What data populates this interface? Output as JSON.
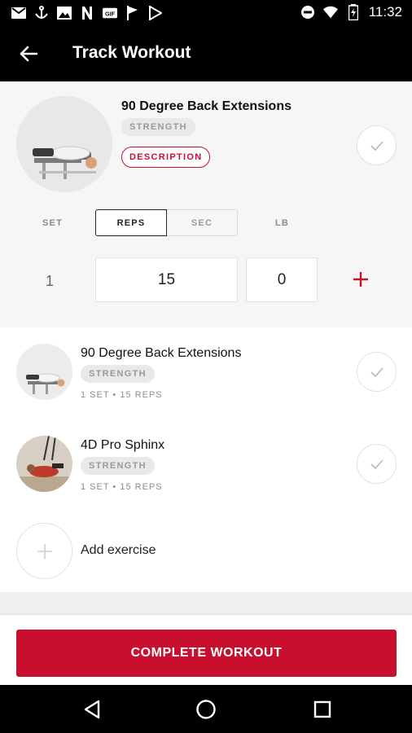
{
  "status_bar": {
    "time": "11:32",
    "left_icons": [
      "gmail-icon",
      "anchor-icon",
      "image-icon",
      "n-icon",
      "gif-icon",
      "flag-icon",
      "play-store-icon"
    ],
    "right_icons": [
      "dnd-icon",
      "wifi-icon",
      "battery-icon"
    ]
  },
  "app_bar": {
    "title": "Track Workout",
    "back_icon": "arrow-left-icon"
  },
  "colors": {
    "accent": "#c8102e",
    "bar_bg": "#000000"
  },
  "active_exercise": {
    "name": "90 Degree Back Extensions",
    "tag": "STRENGTH",
    "description_label": "DESCRIPTION",
    "columns": {
      "set": "SET",
      "reps": "REPS",
      "sec": "SEC",
      "lb": "LB"
    },
    "selected_unit": "REPS",
    "set_number": "1",
    "reps_value": "15",
    "weight_value": "0"
  },
  "exercises": [
    {
      "name": "90 Degree Back Extensions",
      "tag": "STRENGTH",
      "meta": "1 SET • 15 REPS"
    },
    {
      "name": "4D Pro Sphinx",
      "tag": "STRENGTH",
      "meta": "1 SET • 15 REPS"
    }
  ],
  "add_exercise_label": "Add exercise",
  "complete_button_label": "COMPLETE WORKOUT",
  "nav": {
    "back": "nav-back-icon",
    "home": "nav-home-icon",
    "recents": "nav-recents-icon"
  }
}
